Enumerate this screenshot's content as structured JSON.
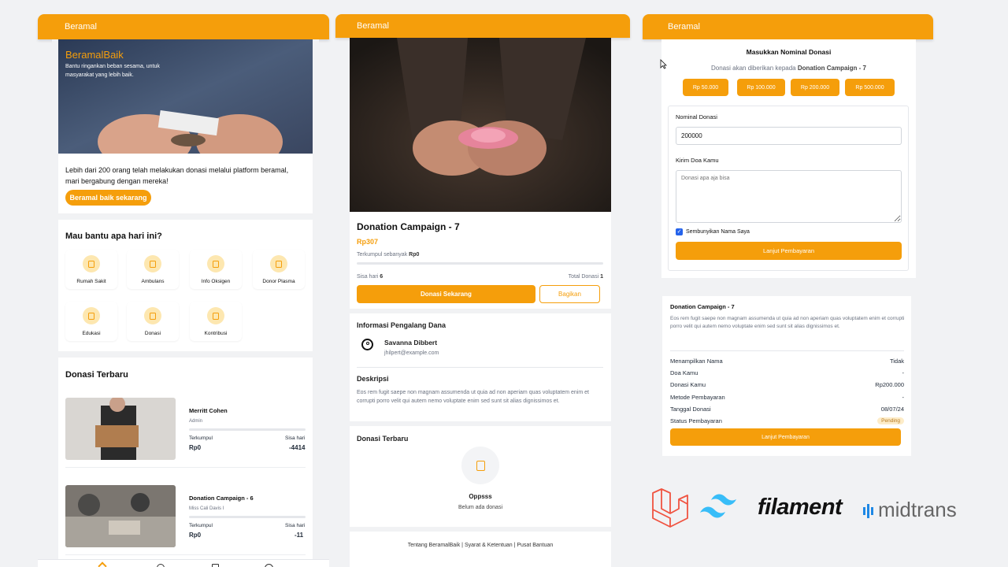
{
  "brand_colors": {
    "accent": "#f59e0b",
    "accent_light": "#fde7b0"
  },
  "panel_home": {
    "header_title": "Beramal",
    "hero": {
      "title": "BeramalBaik",
      "subtitle": "Bantu ringankan beban sesama, untuk masyarakat yang lebih baik."
    },
    "intro_text": "Lebih dari 200 orang telah melakukan donasi melalui platform beramal, mari bergabung dengan mereka!",
    "cta_label": "Beramal baik sekarang",
    "help_title": "Mau bantu apa hari ini?",
    "categories": [
      {
        "label": "Rumah Sakit",
        "icon": "hospital-icon"
      },
      {
        "label": "Ambulans",
        "icon": "ambulance-icon"
      },
      {
        "label": "Info Oksigen",
        "icon": "oxygen-icon"
      },
      {
        "label": "Donor Plasma",
        "icon": "plasma-icon"
      },
      {
        "label": "Edukasi",
        "icon": "book-icon"
      },
      {
        "label": "Donasi",
        "icon": "donate-icon"
      },
      {
        "label": "Kontribusi",
        "icon": "clipboard-icon"
      }
    ],
    "recent_title": "Donasi Terbaru",
    "recent_items": [
      {
        "title": "Merritt Cohen",
        "author": "Admin",
        "collected_label": "Terkumpul",
        "collected": "Rp0",
        "days_label": "Sisa hari",
        "days": "-4414"
      },
      {
        "title": "Donation Campaign - 6",
        "author": "Miss Cali Davis I",
        "collected_label": "Terkumpul",
        "collected": "Rp0",
        "days_label": "Sisa hari",
        "days": "-11"
      }
    ],
    "bottom_nav_icons": [
      "home-icon",
      "heart-icon",
      "bookmark-icon",
      "user-icon"
    ]
  },
  "panel_detail": {
    "header_title": "Beramal",
    "campaign_title": "Donation Campaign - 7",
    "target": "Rp307",
    "collected_prefix": "Terkumpul sebanyak",
    "collected_value": "Rp0",
    "days_prefix": "Sisa hari",
    "days_value": "6",
    "total_prefix": "Total Donasi",
    "total_value": "1",
    "donate_label": "Donasi Sekarang",
    "share_label": "Bagikan",
    "fundraiser_section": "Informasi Pengalang Dana",
    "fundraiser_name": "Savanna Dibbert",
    "fundraiser_email": "jhilpert@example.com",
    "description_title": "Deskripsi",
    "description": "Eos rem fugit saepe non magnam assumenda ut quia ad non aperiam quas voluptatem enim et corrupti porro velit qui autem nemo voluptate enim sed sunt sit alias dignissimos et.",
    "recent_title": "Donasi Terbaru",
    "empty_title": "Oppsss",
    "empty_text": "Belum ada donasi",
    "footer": "Tentang BeramalBaik | Syarat & Ketentuan | Pusat Bantuan"
  },
  "panel_payment": {
    "header_title": "Beramal",
    "form_title": "Masukkan Nominal Donasi",
    "subtitle_prefix": "Donasi akan diberikan kepada",
    "subtitle_campaign": "Donation Campaign - 7",
    "presets": [
      "Rp 50.000",
      "Rp 100.000",
      "Rp 200.000",
      "Rp 500.000"
    ],
    "amount_label": "Nominal Donasi",
    "amount_value": "200000",
    "prayer_label": "Kirim Doa Kamu",
    "prayer_placeholder": "Donasi apa aja bisa",
    "hide_name_label": "Sembunyikan Nama Saya",
    "hide_name_checked": true,
    "continue_label": "Lanjut Pembayaran",
    "summary": {
      "title": "Donation Campaign - 7",
      "description": "Eos rem fugit saepe non magnam assumenda ut quia ad non aperiam quas voluptatem enim et corrupti porro velit qui autem nemo voluptate enim sed sunt sit alias dignissimos et.",
      "rows": [
        {
          "label": "Menampilkan Nama",
          "value": "Tidak"
        },
        {
          "label": "Doa Kamu",
          "value": "-"
        },
        {
          "label": "Donasi Kamu",
          "value": "Rp200.000"
        },
        {
          "label": "Metode Pembayaran",
          "value": "-"
        },
        {
          "label": "Tanggal Donasi",
          "value": "08/07/24"
        },
        {
          "label": "Status Pembayaran",
          "value": "Pending"
        }
      ],
      "continue_label": "Lanjut Pembayaran"
    }
  },
  "logos": {
    "filament": "filament",
    "midtrans": "midtrans"
  }
}
